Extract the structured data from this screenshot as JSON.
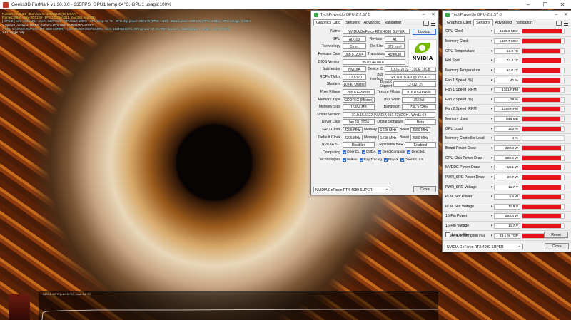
{
  "furmark": {
    "title": "Geeks3D FurMark v1.30.0.0 - 335FPS, GPU1 temp:64°C, GPU1 usage:100%",
    "osd_lines": [
      {
        "text": "FurMark v1.30.0.0 - Burn-in test, 3440x1440 (0X MSAA)",
        "cls": "l"
      },
      {
        "text": "Frames:37840 - time:00:01:49 - FPS:342 (min:331, max:385, avg:335)",
        "cls": "l"
      },
      {
        "text": "[ GPU-Z ] core: 2445 MHz - mem: 1437 MHz - GPU load: 100 % - GPU temp: 63 °C - GPU chip power: 298.6 W (PPW: 1.120) - Board power: 320.3 W (PPW: 1.045) - GPU voltage: 0.950 V",
        "cls": "l c"
      },
      {
        "text": "> OpenGL renderer: NVIDIA GeForce RTX 4080 SUPER/PCIe/SSE2",
        "cls": "l w"
      },
      {
        "text": "> GPU 1 (NVIDIA GeForce RTX 4080 SUPER) - core: 2445MHz/63°C/100%, mem: 11437MHz/4%, GPU power: 97.4% TDP, fan: 41%, limits:[power:1, temp:0, volt:0, OV:0]",
        "cls": "l c"
      },
      {
        "text": "> F1: toggle help",
        "cls": "l w"
      }
    ],
    "graph_label": "GPU 1: 64° C (min: 51° C - max: 64° C)"
  },
  "card_window": {
    "title": "TechPowerUp GPU-Z 2.57.0",
    "tabs": [
      "Graphics Card",
      "Sensors",
      "Advanced",
      "Validation"
    ],
    "fields": {
      "name": "NVIDIA GeForce RTX 4080 SUPER",
      "lookup": "Lookup",
      "gpu": "AD103",
      "revision_label": "Revision",
      "revision": "A1",
      "technology": "5 nm",
      "die_size_label": "Die Size",
      "die_size": "379 mm²",
      "release_date": "Jan 8, 2024",
      "transistors_label": "Transistors",
      "transistors": "45900M",
      "bios_version": "95.03.44.00.61",
      "uefi": "UEFI",
      "subvendor": "NVIDIA",
      "device_id_label": "Device ID",
      "device_id": "10DE 2702 - 10DE 16C8",
      "rops_tmus": "112 / 320",
      "bus_interface_label": "Bus Interface",
      "bus_interface": "PCIe x16 4.0 @ x16 4.0",
      "shaders": "10240 Unified",
      "directx_label": "DirectX Support",
      "directx": "12 (12_2)",
      "pixel_fillrate": "285.6 GPixel/s",
      "texture_fillrate_label": "Texture Fillrate",
      "texture_fillrate": "816.0 GTexel/s",
      "memory_type": "GDDR6X (Micron)",
      "bus_width_label": "Bus Width",
      "bus_width": "256 bit",
      "memory_size": "16384 MB",
      "bandwidth_label": "Bandwidth",
      "bandwidth": "736.3 GB/s",
      "driver_version": "31.0.15.5122 (NVIDIA 551.22) DCH / Win11 64",
      "driver_date": "Jan 18, 2024",
      "digital_signature_label": "Digital Signature",
      "digital_signature": "Beta",
      "gpu_clock": "2295 MHz",
      "gpu_memory": "1438 MHz",
      "gpu_boost": "2550 MHz",
      "default_clock": "2295 MHz",
      "default_memory": "1438 MHz",
      "default_boost": "2550 MHz",
      "nvidia_sli": "Disabled",
      "resizable_bar_label": "Resizable BAR",
      "resizable_bar": "Enabled",
      "memory_label": "Memory",
      "boost_label": "Boost"
    },
    "labels": {
      "name": "Name",
      "gpu": "GPU",
      "technology": "Technology",
      "release_date": "Release Date",
      "bios_version": "BIOS Version",
      "subvendor": "Subvendor",
      "rops_tmus": "ROPs/TMUs",
      "shaders": "Shaders",
      "pixel_fillrate": "Pixel Fillrate",
      "memory_type": "Memory Type",
      "memory_size": "Memory Size",
      "driver_version": "Driver Version",
      "driver_date": "Driver Date",
      "gpu_clock": "GPU Clock",
      "default_clock": "Default Clock",
      "nvidia_sli": "NVIDIA SLI",
      "computing": "Computing",
      "technologies": "Technologies"
    },
    "computing": [
      "OpenCL",
      "CUDA",
      "DirectCompute",
      "DirectML"
    ],
    "technologies": [
      "Vulkan",
      "Ray Tracing",
      "PhysX",
      "OpenGL 4.6"
    ],
    "logo_text": "NVIDIA",
    "selected_card": "NVIDIA GeForce RTX 4080 SUPER",
    "close": "Close"
  },
  "sensors_window": {
    "title": "TechPowerUp GPU-Z 2.57.0",
    "tabs": [
      "Graphics Card",
      "Sensors",
      "Advanced",
      "Validation"
    ],
    "rows": [
      {
        "name": "GPU Clock",
        "value": "2445.0 MHz",
        "level": 0.95
      },
      {
        "name": "Memory Clock",
        "value": "1437.7 MHz",
        "level": 0.93
      },
      {
        "name": "GPU Temperature",
        "value": "63.0 °C",
        "level": 0.92
      },
      {
        "name": "Hot Spot",
        "value": "73.4 °C",
        "level": 0.93
      },
      {
        "name": "Memory Temperature",
        "value": "62.0 °C",
        "level": 0.92
      },
      {
        "name": "Fan 1 Speed (%)",
        "value": "41 %",
        "level": 0.92
      },
      {
        "name": "Fan 1 Speed (RPM)",
        "value": "1361 RPM",
        "level": 0.92
      },
      {
        "name": "Fan 2 Speed (%)",
        "value": "39 %",
        "level": 0.92
      },
      {
        "name": "Fan 2 Speed (RPM)",
        "value": "1295 RPM",
        "level": 0.92
      },
      {
        "name": "Memory Used",
        "value": "845 MB",
        "level": 0.92
      },
      {
        "name": "GPU Load",
        "value": "100 %",
        "level": 0.93
      },
      {
        "name": "Memory Controller Load",
        "value": "4 %",
        "level": 0.0
      },
      {
        "name": "Board Power Draw",
        "value": "320.3 W",
        "level": 0.93
      },
      {
        "name": "GPU Chip Power Draw",
        "value": "298.6 W",
        "level": 0.93
      },
      {
        "name": "MVDDC Power Draw",
        "value": "18.1 W",
        "level": 0.93
      },
      {
        "name": "PWR_SRC Power Draw",
        "value": "22.7 W",
        "level": 0.93
      },
      {
        "name": "PWR_SRC Voltage",
        "value": "11.7 V",
        "level": 0.93
      },
      {
        "name": "PCIe Slot Power",
        "value": "4.5 W",
        "level": 0.93
      },
      {
        "name": "PCIe Slot Voltage",
        "value": "11.8 V",
        "level": 0.93
      },
      {
        "name": "16-Pin Power",
        "value": "293.4 W",
        "level": 0.93
      },
      {
        "name": "16-Pin Voltage",
        "value": "11.7 V",
        "level": 0.93
      },
      {
        "name": "Power Consumption (%)",
        "value": "93.1 % TDP",
        "level": 0.93
      }
    ],
    "log_to_file": "Log to file",
    "reset": "Reset",
    "selected_card": "NVIDIA GeForce RTX 4080 SUPER",
    "close": "Close"
  }
}
